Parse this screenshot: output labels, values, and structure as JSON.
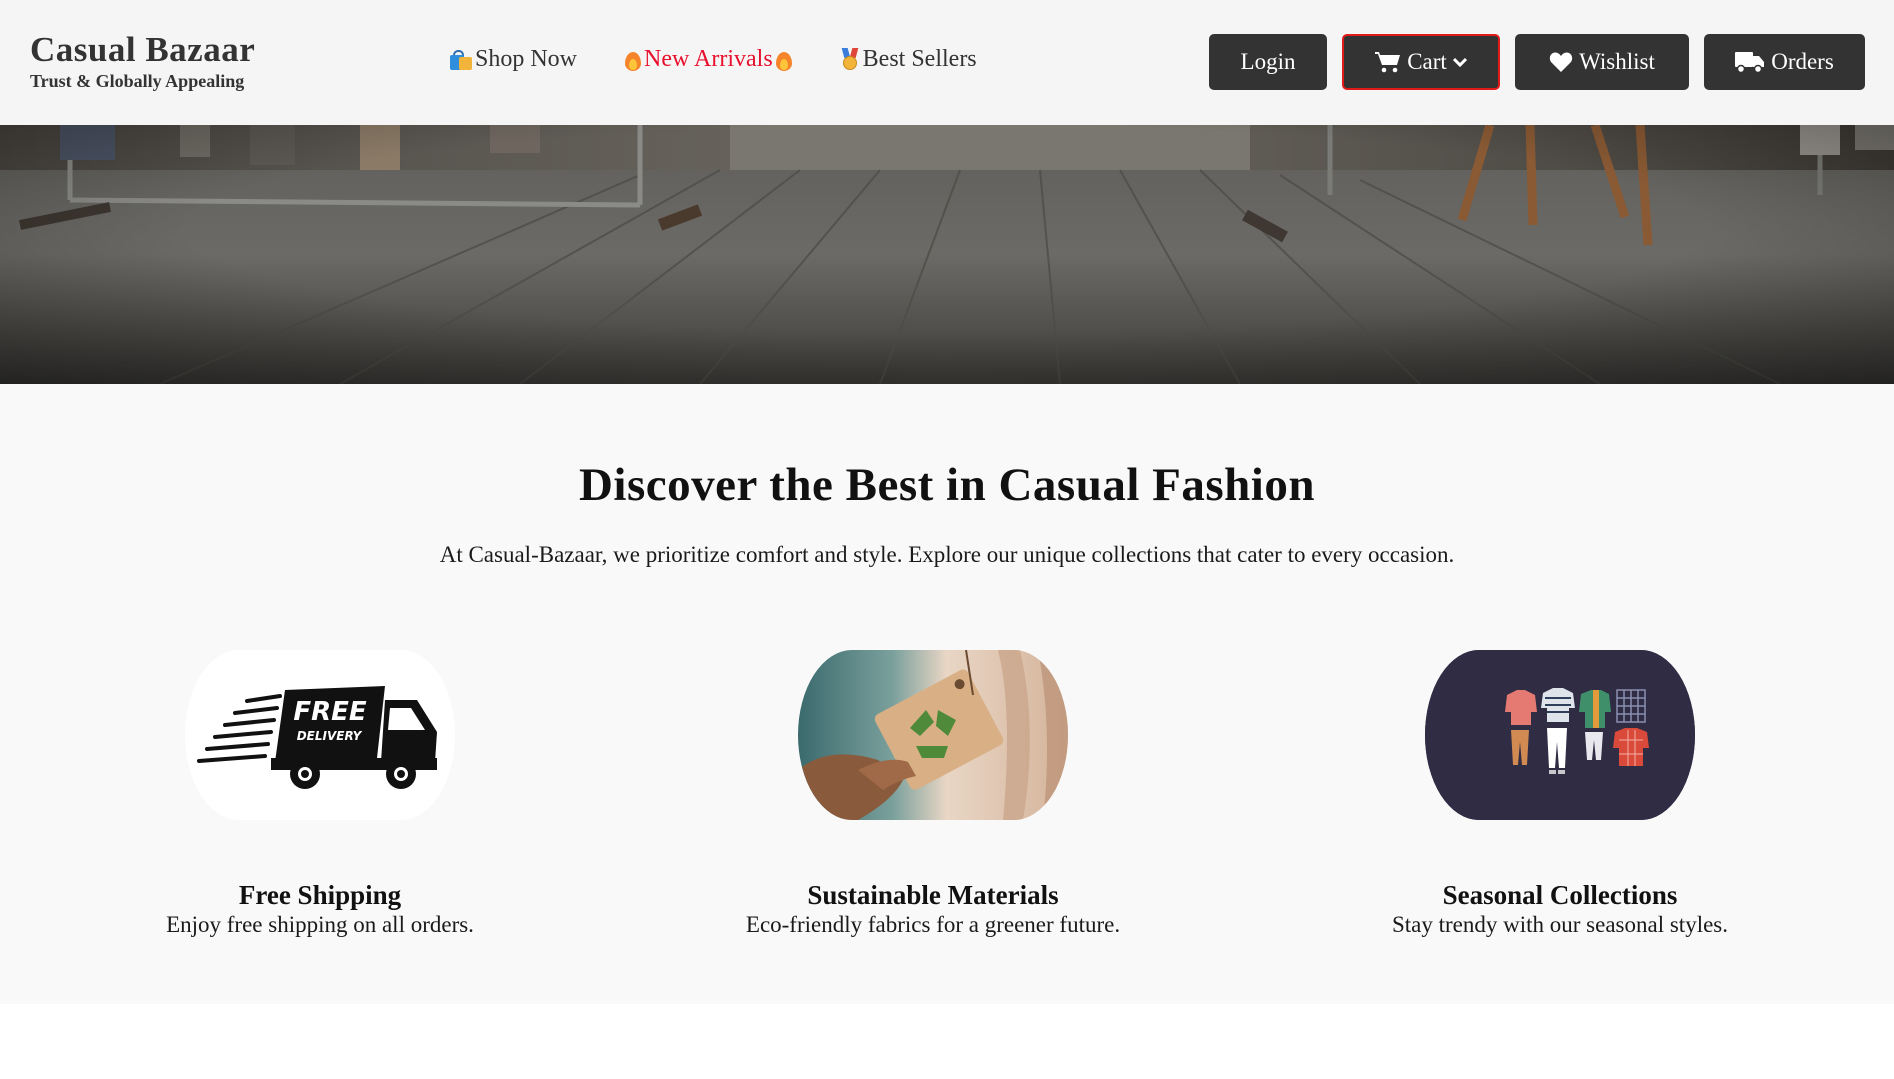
{
  "brand": {
    "name": "Casual Bazaar",
    "tagline": "Trust & Globally Appealing"
  },
  "nav": {
    "items": [
      {
        "label": "Shop Now",
        "icon": "shopping-bags-emoji"
      },
      {
        "label": "New Arrivals",
        "icon": "fire-emoji",
        "color": "#e8112d"
      },
      {
        "label": "Best Sellers",
        "icon": "medal-emoji"
      }
    ]
  },
  "actions": {
    "login": "Login",
    "cart": "Cart",
    "wishlist": "Wishlist",
    "orders": "Orders"
  },
  "hero": {
    "image": "clothing-store-floor-photo"
  },
  "main": {
    "heading": "Discover the Best in Casual Fashion",
    "lead": "At Casual-Bazaar, we prioritize comfort and style. Explore our unique collections that cater to every occasion.",
    "features": [
      {
        "title": "Free Shipping",
        "description": "Enjoy free shipping on all orders.",
        "image": "free-delivery-truck",
        "image_text": [
          "FREE",
          "DELIVERY"
        ]
      },
      {
        "title": "Sustainable Materials",
        "description": "Eco-friendly fabrics for a greener future.",
        "image": "recycle-tag-photo"
      },
      {
        "title": "Seasonal Collections",
        "description": "Stay trendy with our seasonal styles.",
        "image": "clothing-collection-illustration"
      }
    ]
  },
  "colors": {
    "header_bg": "#f5f5f5",
    "button_bg": "#333333",
    "cart_border": "#e11a1a",
    "accent_red": "#e8112d",
    "main_bg": "#f9f9f9"
  }
}
